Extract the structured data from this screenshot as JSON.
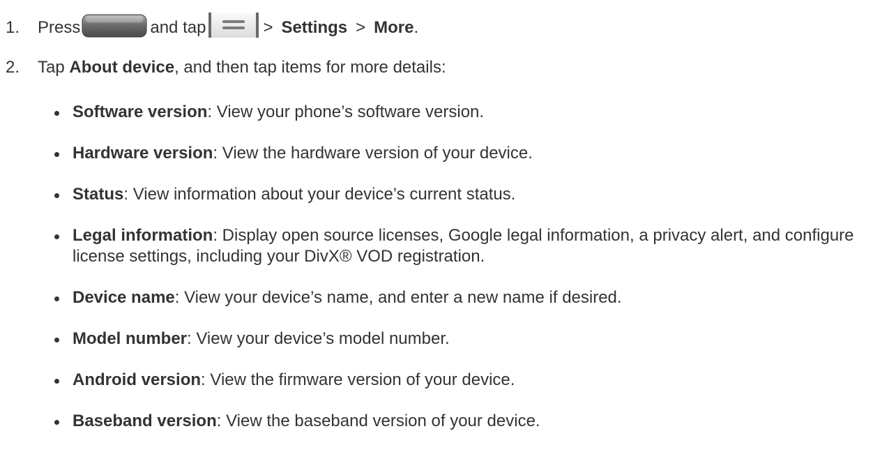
{
  "steps": [
    {
      "number": "1.",
      "press_label": "Press",
      "and_tap_label": "and tap",
      "gt1": ">",
      "settings_label": "Settings",
      "gt2": ">",
      "more_label": "More",
      "end_punct": "."
    },
    {
      "number": "2.",
      "tap_label": "Tap",
      "about_label": "About device",
      "rest": ", and then tap items for more details:"
    }
  ],
  "icons": {
    "home_key": "home-key-icon",
    "menu_key": "menu-key-icon"
  },
  "items": [
    {
      "term": "Software version",
      "desc": ": View your phone’s software version."
    },
    {
      "term": "Hardware version",
      "desc": ": View the hardware version of your device."
    },
    {
      "term": "Status",
      "desc": ": View information about your device’s current status."
    },
    {
      "term": "Legal information",
      "desc": ": Display open source licenses, Google legal information, a privacy alert, and configure license settings, including your DivX® VOD registration."
    },
    {
      "term": "Device name",
      "desc": ": View your device’s name, and enter a new name if desired."
    },
    {
      "term": "Model number",
      "desc": ": View your device’s model number."
    },
    {
      "term": "Android version",
      "desc": ": View the firmware version of your device."
    },
    {
      "term": "Baseband version",
      "desc": ": View the baseband version of your device."
    }
  ],
  "colors": {
    "text": "#333333",
    "key_dark": "#5a5a5a",
    "key_light": "#9a9a9a"
  }
}
